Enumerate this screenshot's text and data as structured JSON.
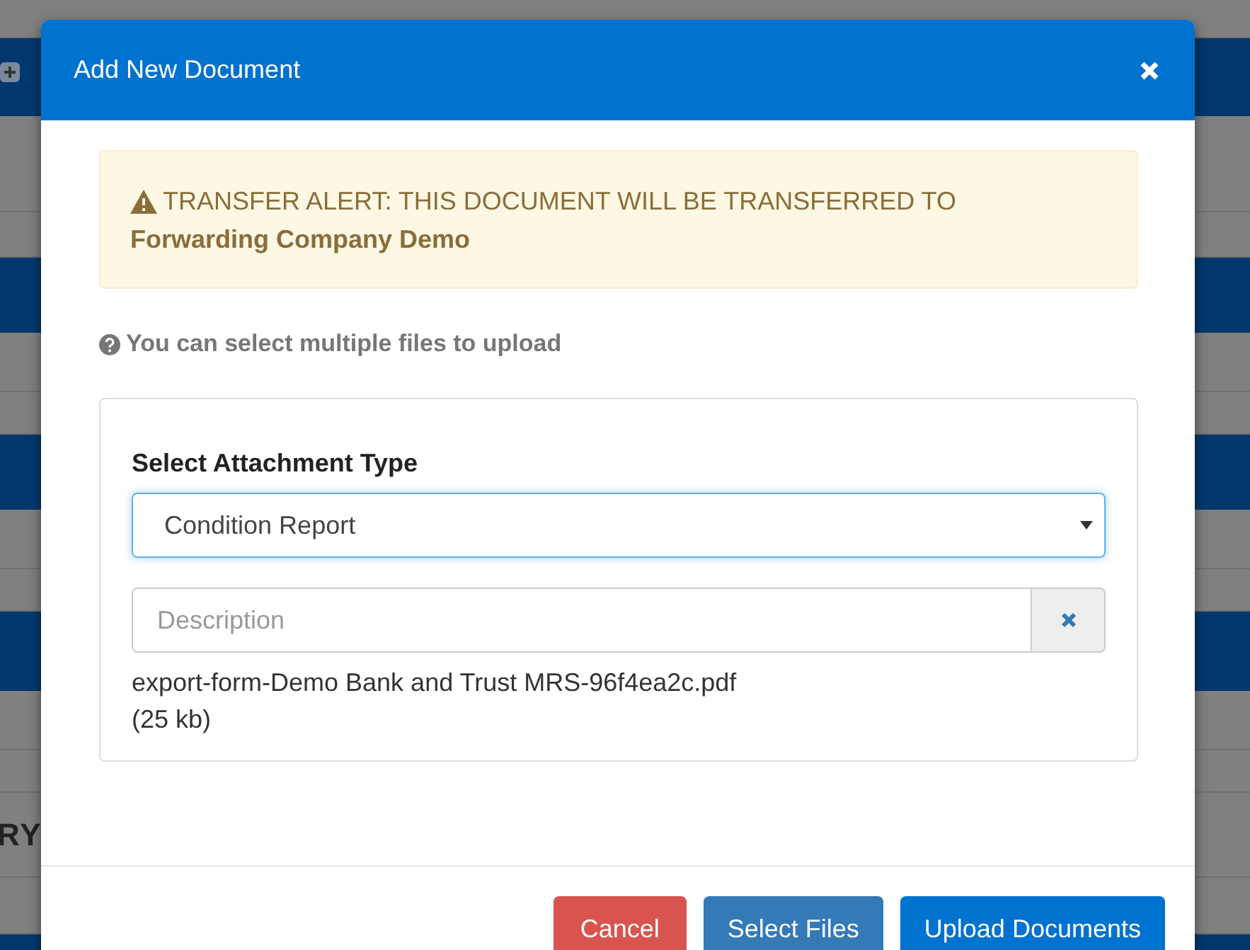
{
  "background": {
    "text_fragment": "RY"
  },
  "modal": {
    "title": "Add New Document",
    "alert": {
      "text": "TRANSFER ALERT: THIS DOCUMENT WILL BE TRANSFERRED TO",
      "recipient": "Forwarding Company Demo"
    },
    "help": "You can select multiple files to upload",
    "form": {
      "label": "Select Attachment Type",
      "attachment_type": "Condition Report",
      "description": {
        "placeholder": "Description"
      },
      "file_name": "export-form-Demo Bank and Trust MRS-96f4ea2c.pdf",
      "file_size": "(25 kb)"
    },
    "buttons": [
      {
        "label": "Cancel",
        "kind": "danger"
      },
      {
        "label": "Select Files",
        "kind": "secondary"
      },
      {
        "label": "Upload Documents",
        "kind": "primary"
      }
    ]
  }
}
